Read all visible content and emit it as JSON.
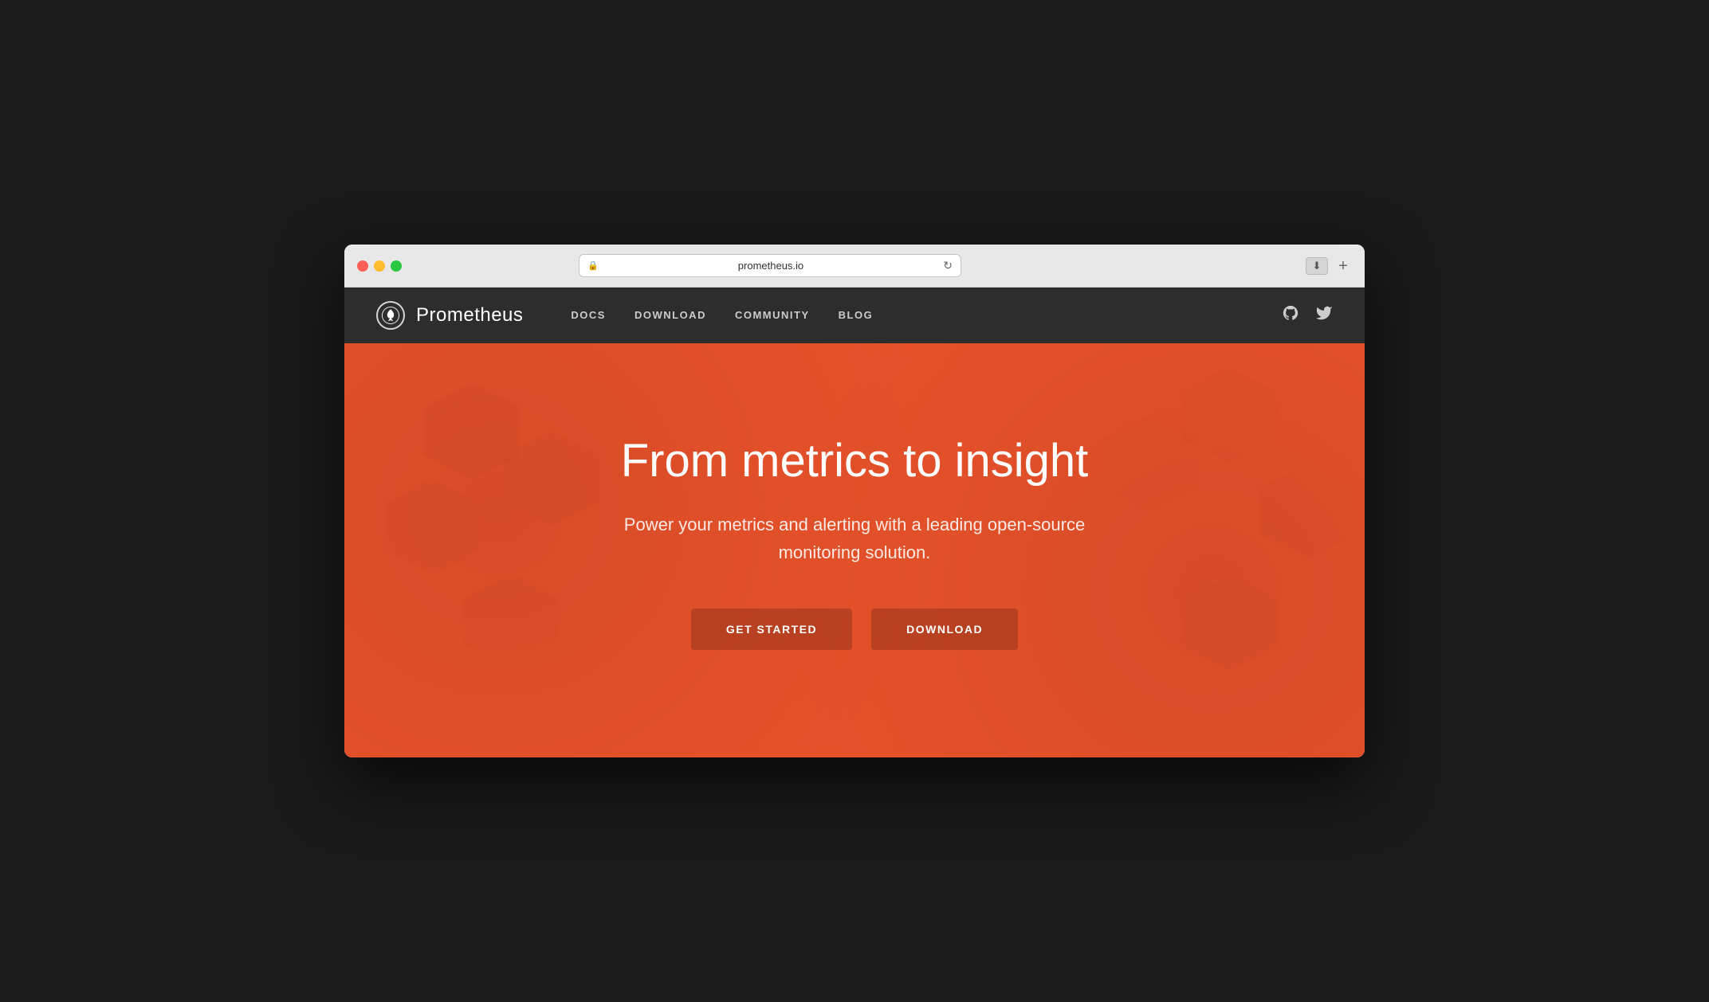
{
  "browser": {
    "url": "prometheus.io",
    "lock_icon": "🔒",
    "reload_icon": "↻",
    "download_icon": "⬇",
    "new_tab_icon": "+"
  },
  "navbar": {
    "brand_name": "Prometheus",
    "nav_items": [
      {
        "label": "DOCS",
        "href": "#"
      },
      {
        "label": "DOWNLOAD",
        "href": "#"
      },
      {
        "label": "COMMUNITY",
        "href": "#"
      },
      {
        "label": "BLOG",
        "href": "#"
      }
    ],
    "github_icon": "github-icon",
    "twitter_icon": "twitter-icon"
  },
  "hero": {
    "title": "From metrics to insight",
    "subtitle": "Power your metrics and alerting with a leading open-source monitoring solution.",
    "btn_get_started": "GET STARTED",
    "btn_download": "DOWNLOAD"
  },
  "traffic_lights": {
    "red": "red",
    "yellow": "yellow",
    "green": "green"
  }
}
